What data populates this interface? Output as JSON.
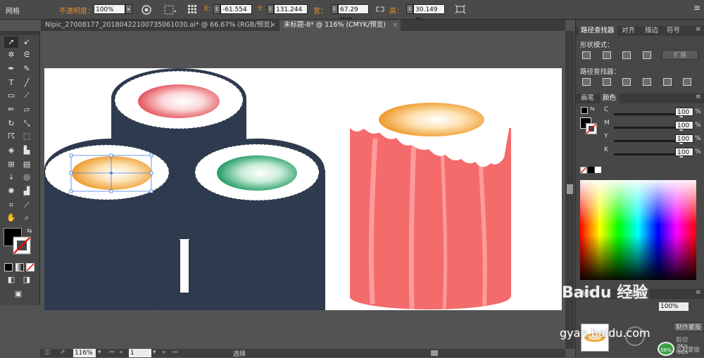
{
  "control_bar": {
    "mode_label": "网格",
    "opacity_label": "不透明度：",
    "opacity_value": "100%",
    "x_label": "X:",
    "x_value": "-61.554",
    "y_label": "Y:",
    "y_value": "131.244",
    "width_label": "宽：",
    "width_value": "67.29 mm",
    "height_label": "高：",
    "height_value": "30.149 m"
  },
  "tabs": [
    {
      "label": "Nipic_27008177_20180422100735061030.ai* @ 66.67% (RGB/预览)",
      "active": false
    },
    {
      "label": "未标题-8* @ 116% (CMYK/预览)",
      "active": true
    }
  ],
  "status_bar": {
    "zoom": "116%",
    "page": "1",
    "tool": "选择"
  },
  "pathfinder_panel": {
    "tabs": [
      "路径查找器",
      "对齐",
      "描边",
      "符号"
    ],
    "shape_modes_label": "形状模式：",
    "expand_button": "扩展",
    "pathfinders_label": "路径查找器："
  },
  "color_panel": {
    "tabs": [
      "画笔",
      "颜色"
    ],
    "channels": [
      {
        "letter": "C",
        "value": "100",
        "fraction": 1.0
      },
      {
        "letter": "M",
        "value": "100",
        "fraction": 1.0
      },
      {
        "letter": "Y",
        "value": "100",
        "fraction": 1.0
      },
      {
        "letter": "K",
        "value": "100",
        "fraction": 1.0
      }
    ],
    "percent_sign": "%"
  },
  "transparency_panel": {
    "tabs": [
      "渐变",
      "透明度"
    ],
    "opacity_value": "100%",
    "make_mask_button": "制作蒙版",
    "clip_label": "剪切",
    "invert_label": "反相蒙版"
  },
  "watermark": {
    "brand": "Baidu 经验",
    "url": "gyan.baidu.com"
  },
  "system_tray": {
    "cpu_percent": "58%",
    "speed_up": "0K/s",
    "speed_down": "0K/s"
  },
  "colors": {
    "roll_dark": "#2e3a4d",
    "rice": "#ffffff",
    "salmon_body": "#f46b6b",
    "salmon_stripe": "#ff9a9a",
    "egg_orange": "#f0a437",
    "cucumber_green": "#2fa06a",
    "tuna_pink": "#ea5a5e",
    "selection_blue": "#4a7fdb"
  }
}
